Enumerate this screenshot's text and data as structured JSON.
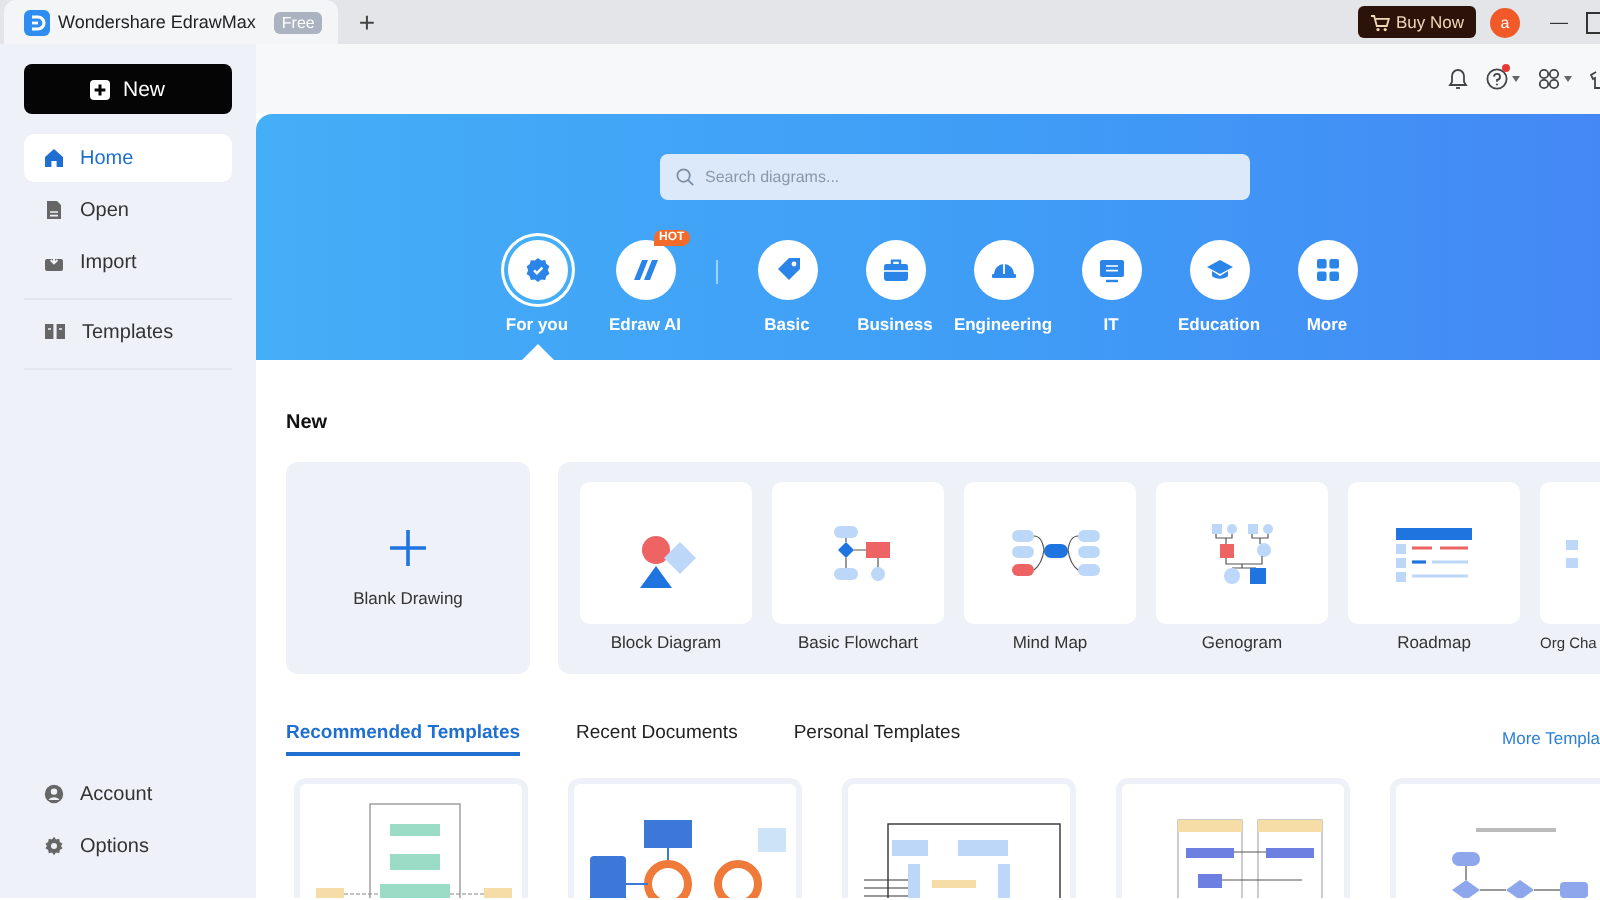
{
  "app_tab": {
    "title": "Wondershare EdrawMax",
    "badge": "Free",
    "new_tab": "+"
  },
  "title_bar": {
    "buy_button": "Buy Now",
    "avatar": "a",
    "minimize": "—"
  },
  "sidebar": {
    "new_button": "New",
    "items": [
      {
        "label": "Home",
        "selected": true
      },
      {
        "label": "Open",
        "selected": false
      },
      {
        "label": "Import",
        "selected": false
      },
      {
        "label": "Templates",
        "selected": false
      }
    ],
    "bottom_items": [
      {
        "label": "Account"
      },
      {
        "label": "Options"
      }
    ]
  },
  "toolbar": {
    "help_notification": true
  },
  "hero": {
    "search": {
      "placeholder": "Search diagrams..."
    },
    "categories": [
      {
        "label": "For you",
        "selected": true
      },
      {
        "label": "Edraw AI",
        "selected": false,
        "badge": "HOT"
      },
      {
        "label": "Basic",
        "selected": false
      },
      {
        "label": "Business",
        "selected": false
      },
      {
        "label": "Engineering",
        "selected": false
      },
      {
        "label": "IT",
        "selected": false
      },
      {
        "label": "Education",
        "selected": false
      },
      {
        "label": "More",
        "selected": false
      }
    ]
  },
  "new_section": {
    "title": "New",
    "blank_drawing": "Blank Drawing",
    "templates": [
      {
        "label": "Block Diagram",
        "kind": "block"
      },
      {
        "label": "Basic Flowchart",
        "kind": "flowchart"
      },
      {
        "label": "Mind Map",
        "kind": "mindmap"
      },
      {
        "label": "Genogram",
        "kind": "genogram"
      },
      {
        "label": "Roadmap",
        "kind": "roadmap"
      },
      {
        "label": "Org Cha",
        "kind": "org"
      }
    ]
  },
  "template_tabs": [
    {
      "label": "Recommended Templates",
      "selected": true
    },
    {
      "label": "Recent Documents",
      "selected": false
    },
    {
      "label": "Personal Templates",
      "selected": false
    }
  ],
  "more_link": "More Templa",
  "recommended": [
    {
      "kind": "network"
    },
    {
      "kind": "business"
    },
    {
      "kind": "circuit"
    },
    {
      "kind": "swimlane"
    },
    {
      "kind": "flowchart"
    }
  ]
}
